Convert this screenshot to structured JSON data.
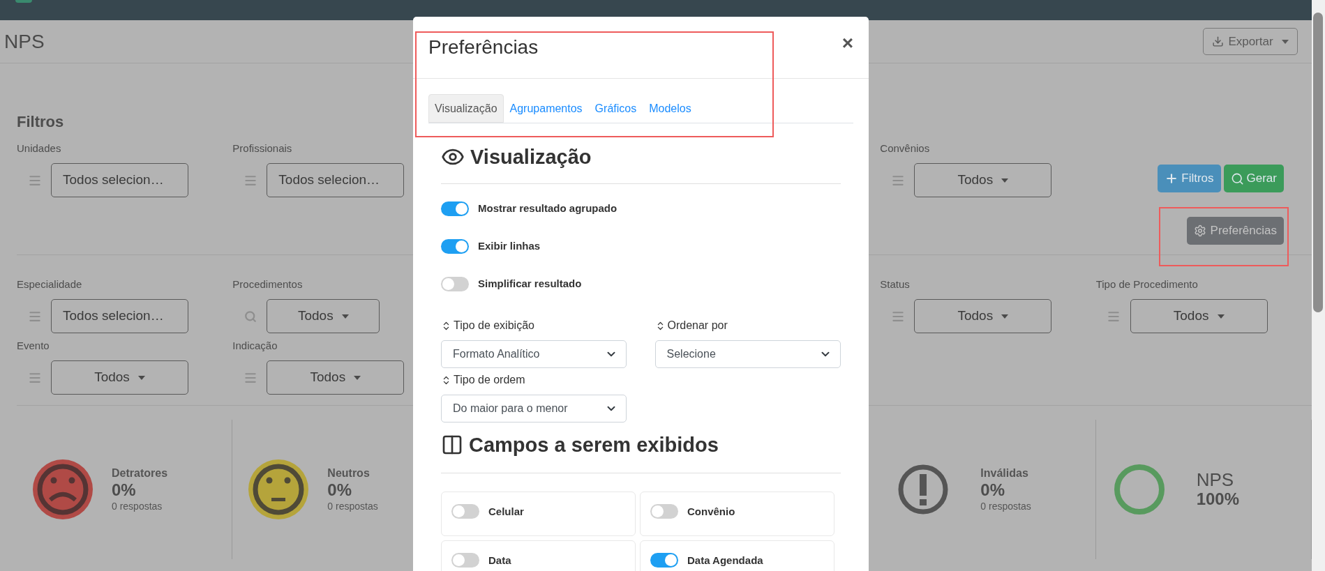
{
  "page": {
    "title": "NPS",
    "export_button": "Exportar"
  },
  "filters": {
    "title": "Filtros",
    "rows": [
      {
        "left": [
          {
            "label": "Unidades",
            "value": "Todos selecion…",
            "kind": "multi"
          },
          {
            "label": "Profissionais",
            "value": "Todos selecion…",
            "kind": "multi"
          }
        ],
        "right": [
          {
            "label": "Convênios",
            "value": "Todos",
            "kind": "dropdown"
          }
        ]
      },
      {
        "left": [
          {
            "label": "Especialidade",
            "value": "Todos selecion…",
            "kind": "multi"
          },
          {
            "label": "Procedimentos",
            "value": "Todos",
            "kind": "search"
          }
        ],
        "right": [
          {
            "label": "Status",
            "value": "Todos",
            "kind": "dropdown"
          },
          {
            "label": "Tipo de Procedimento",
            "value": "Todos",
            "kind": "dropdown"
          }
        ]
      },
      {
        "left": [
          {
            "label": "Evento",
            "value": "Todos",
            "kind": "dropdown"
          },
          {
            "label": "Indicação",
            "value": "Todos",
            "kind": "dropdown"
          }
        ],
        "right": []
      }
    ],
    "actions": [
      {
        "label": "Filtros",
        "kind": "add"
      },
      {
        "label": "Gerar",
        "kind": "generate"
      }
    ],
    "preferences_button": "Preferências"
  },
  "stats": {
    "left": [
      {
        "kind": "sad",
        "title": "Detratores",
        "value": "0%",
        "note": "0 respostas"
      },
      {
        "kind": "neutral",
        "title": "Neutros",
        "value": "0%",
        "note": "0 respostas"
      }
    ],
    "right": [
      {
        "kind": "warning",
        "title": "Inválidas",
        "value": "0%",
        "note": "0 respostas"
      },
      {
        "kind": "score",
        "title": "NPS",
        "value": "100%"
      }
    ]
  },
  "modal": {
    "title": "Preferências",
    "close": "×",
    "tabs": [
      {
        "label": "Visualização",
        "selected": true
      },
      {
        "label": "Agrupamentos",
        "selected": false
      },
      {
        "label": "Gráficos",
        "selected": false
      },
      {
        "label": "Modelos",
        "selected": false
      }
    ],
    "view_heading": "Visualização",
    "toggles": [
      {
        "label": "Mostrar resultado agrupado",
        "on": true
      },
      {
        "label": "Exibir linhas",
        "on": true
      },
      {
        "label": "Simplificar resultado",
        "on": false
      }
    ],
    "selects": [
      {
        "label": "Tipo de exibição",
        "value": "Formato Analítico"
      },
      {
        "label": "Ordenar por",
        "value": "Selecione"
      },
      {
        "label": "Tipo de ordem",
        "value": "Do maior para o menor"
      }
    ],
    "fields_heading": "Campos a serem exibidos",
    "fields": [
      {
        "label": "Celular",
        "on": false
      },
      {
        "label": "Convênio",
        "on": false
      },
      {
        "label": "Data",
        "on": false
      },
      {
        "label": "Data Agendada",
        "on": true
      }
    ]
  }
}
